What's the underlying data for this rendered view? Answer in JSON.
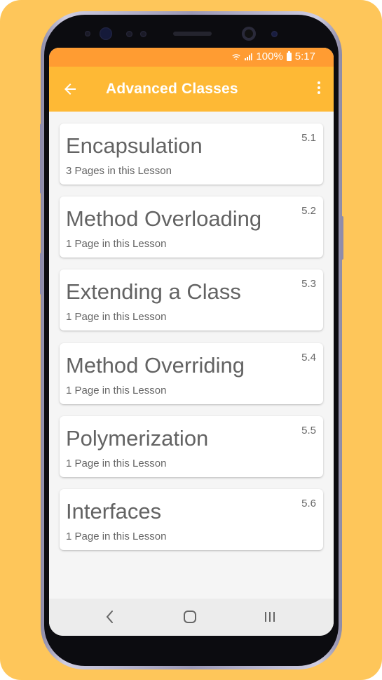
{
  "status": {
    "battery": "100%",
    "time": "5:17"
  },
  "app_bar": {
    "title": "Advanced Classes"
  },
  "lessons": [
    {
      "title": "Encapsulation",
      "pages": "3 Pages in this Lesson",
      "number": "5.1"
    },
    {
      "title": "Method Overloading",
      "pages": "1 Page in this Lesson",
      "number": "5.2"
    },
    {
      "title": "Extending a Class",
      "pages": "1 Page in this Lesson",
      "number": "5.3"
    },
    {
      "title": "Method Overriding",
      "pages": "1 Page in this Lesson",
      "number": "5.4"
    },
    {
      "title": "Polymerization",
      "pages": "1 Page in this Lesson",
      "number": "5.5"
    },
    {
      "title": "Interfaces",
      "pages": "1 Page in this Lesson",
      "number": "5.6"
    }
  ],
  "colors": {
    "background": "#fec65a",
    "status_bar": "#ff9c32",
    "app_bar": "#feb935",
    "card_text": "#636363"
  },
  "icons": {
    "back": "arrow-left-icon",
    "more": "more-vert-icon",
    "nav_back": "chevron-left-icon",
    "nav_home": "home-rounded-square-icon",
    "nav_recents": "recents-bars-icon"
  }
}
